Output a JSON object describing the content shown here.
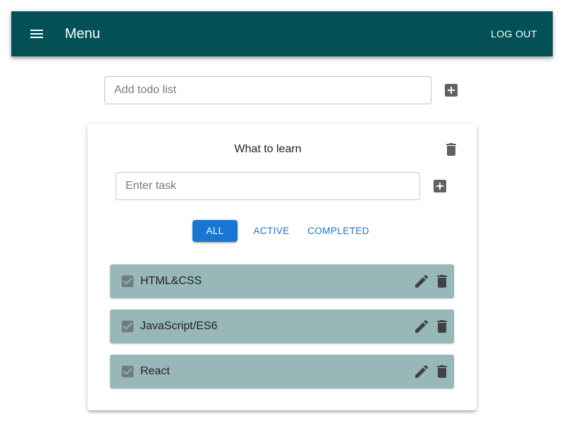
{
  "header": {
    "title": "Menu",
    "logout_label": "LOG OUT",
    "menu_icon": "hamburger-menu-icon",
    "background": "#035157"
  },
  "add_list": {
    "placeholder": "Add todo list",
    "value": "",
    "button_icon": "add-box-icon"
  },
  "todolist": {
    "title": "What to learn",
    "delete_icon": "trash-icon",
    "task_input": {
      "placeholder": "Enter task",
      "value": ""
    },
    "filters": {
      "all": "ALL",
      "active": "ACTIVE",
      "completed": "COMPLETED",
      "selected": "all"
    },
    "tasks": [
      {
        "label": "HTML&CSS",
        "checked": true
      },
      {
        "label": "JavaScript/ES6",
        "checked": true
      },
      {
        "label": "React",
        "checked": true
      }
    ],
    "colors": {
      "task_background": "#98b7b9",
      "accent": "#1976d2"
    }
  }
}
